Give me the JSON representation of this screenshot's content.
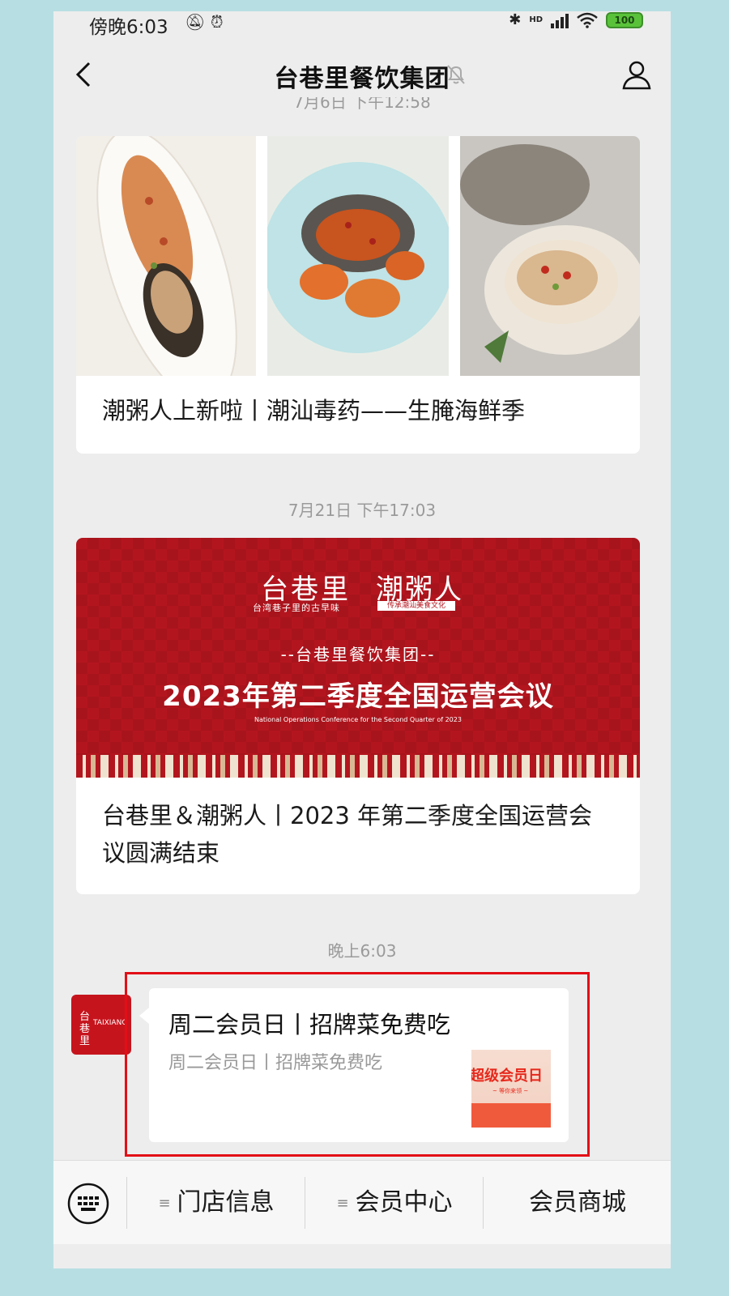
{
  "status_bar": {
    "time": "傍晚6:03",
    "network": "HD",
    "battery": "100"
  },
  "header": {
    "title": "台巷里餐饮集团"
  },
  "timestamps": {
    "t0": "7月6日 下午12:58",
    "t1": "7月21日 下午17:03",
    "t2": "晚上6:03"
  },
  "articles": [
    {
      "caption": "潮粥人上新啦丨潮汕毒药——生腌海鲜季"
    },
    {
      "caption": "台巷里＆潮粥人丨2023 年第二季度全国运营会议圆满结束",
      "banner": {
        "brand_a": "台巷里",
        "brand_a_sub": "台湾巷子里的古早味",
        "brand_b": "潮粥人",
        "brand_b_sub": "传承潮汕美食文化",
        "group": "--台巷里餐饮集团--",
        "headline": "2023年第二季度全国运营会议",
        "subtitle_en": "National Operations Conference for the Second Quarter of 2023"
      }
    }
  ],
  "message": {
    "avatar_text": "台巷里",
    "avatar_en": "TAIXIANG",
    "title": "周二会员日丨招牌菜免费吃",
    "description": "周二会员日丨招牌菜免费吃",
    "thumb_title": "超级会员日",
    "thumb_sub": "~ 等你来领 ~"
  },
  "bottom_menu": {
    "item1": "门店信息",
    "item2": "会员中心",
    "item3": "会员商城",
    "menu_icon": "≡"
  },
  "colors": {
    "brand_red": "#b3151e",
    "highlight": "#e30f16",
    "page_bg": "#ededed"
  }
}
